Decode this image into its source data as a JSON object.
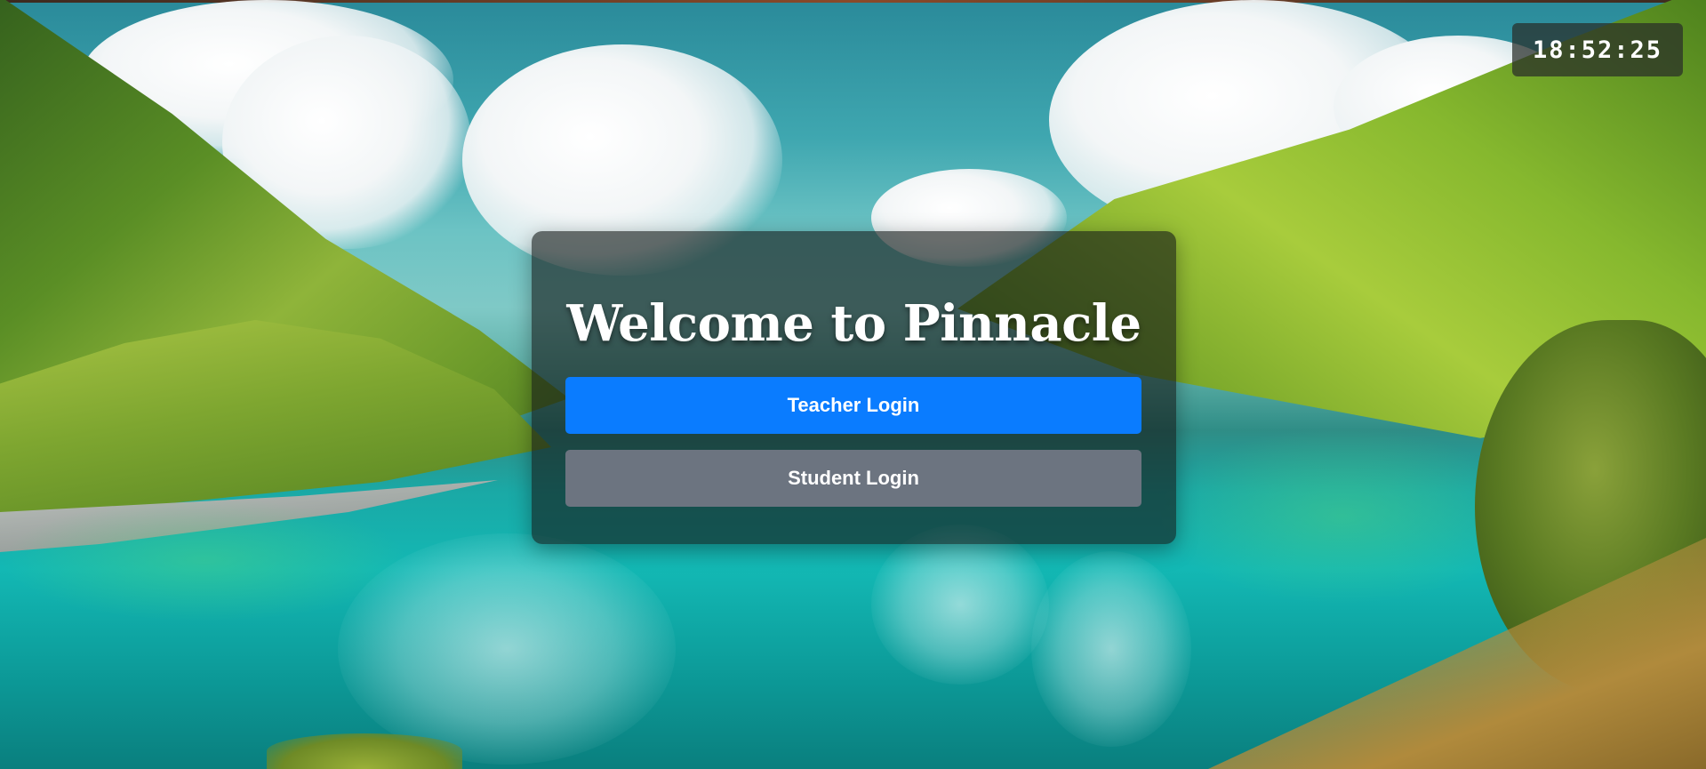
{
  "clock": {
    "time": "18:52:25"
  },
  "login": {
    "title": "Welcome to Pinnacle",
    "teacher_button_label": "Teacher Login",
    "student_button_label": "Student Login"
  },
  "colors": {
    "teacher_button": "#0a7cff",
    "student_button": "#6c7480",
    "panel_overlay": "#141816"
  }
}
